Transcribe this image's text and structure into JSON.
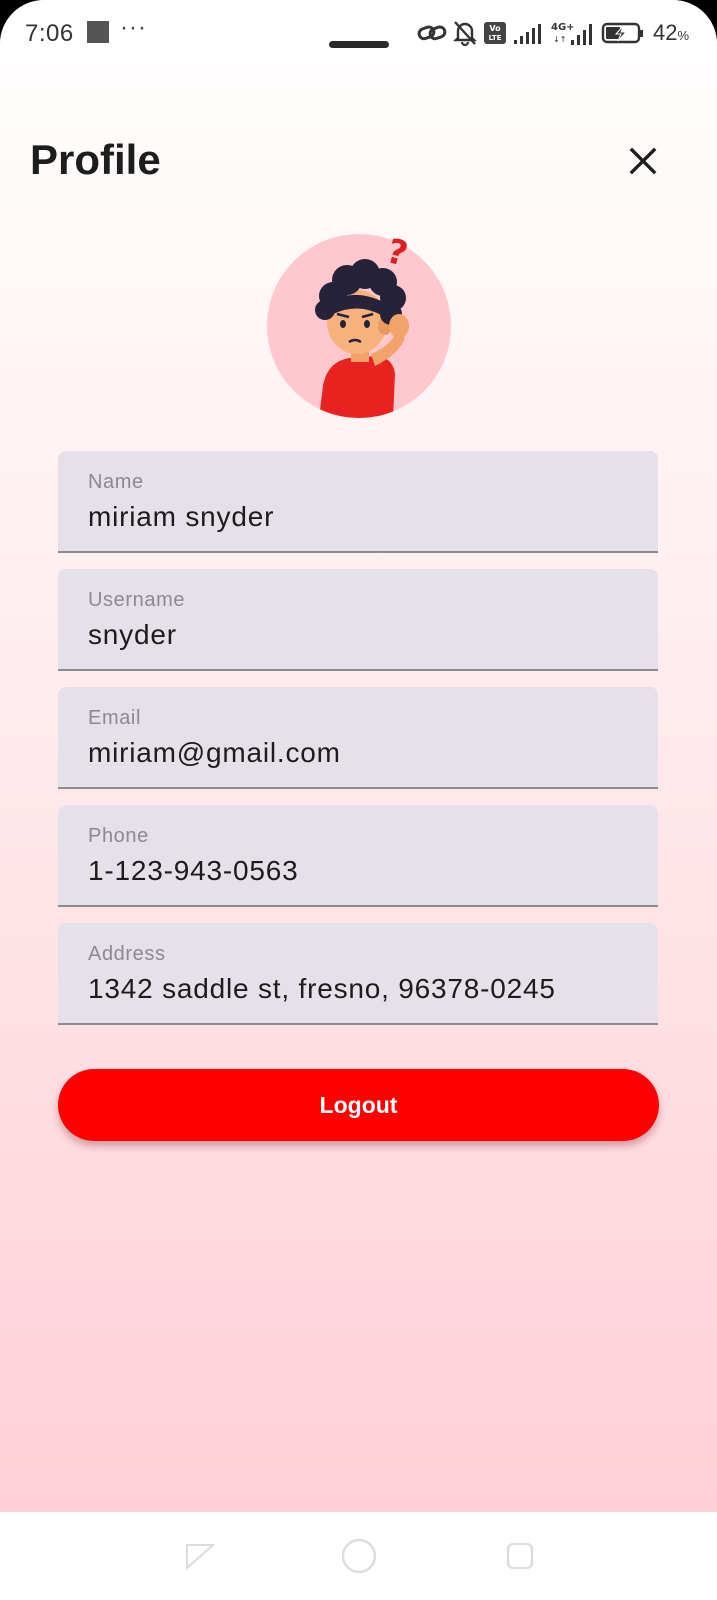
{
  "status_bar": {
    "time": "7:06",
    "overflow": "···",
    "battery_percent": "42",
    "battery_unit": "%",
    "network_icons": [
      "link-icon",
      "bell-off-icon",
      "volte-icon",
      "signal-icon",
      "4g-signal-icon",
      "battery-charging-icon"
    ]
  },
  "header": {
    "title": "Profile",
    "close_icon": "close-icon"
  },
  "avatar": {
    "icon": "confused-person-avatar"
  },
  "fields": [
    {
      "label": "Name",
      "value": "miriam snyder"
    },
    {
      "label": "Username",
      "value": "snyder"
    },
    {
      "label": "Email",
      "value": "miriam@gmail.com"
    },
    {
      "label": "Phone",
      "value": "1-123-943-0563"
    },
    {
      "label": "Address",
      "value": "1342 saddle st, fresno, 96378-0245"
    }
  ],
  "logout_label": "Logout",
  "colors": {
    "accent": "#ff0000",
    "field_bg": "#e6e0e8",
    "background_top": "#ffffff",
    "background_bottom": "#ffd0d7"
  },
  "nav_bar": {
    "back_icon": "back-triangle-icon",
    "home_icon": "home-circle-icon",
    "recents_icon": "recents-square-icon"
  }
}
